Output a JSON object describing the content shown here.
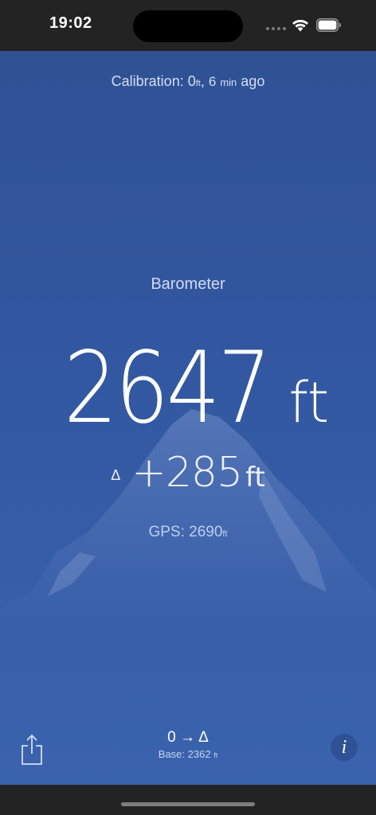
{
  "status_bar": {
    "time": "19:02"
  },
  "calibration": {
    "prefix": "Calibration: ",
    "value": "0",
    "value_unit": "ft",
    "separator": ", ",
    "minutes": "6",
    "minutes_unit": "min",
    "suffix": " ago"
  },
  "reading": {
    "mode": "Barometer",
    "altitude": "2647",
    "altitude_unit": "ft",
    "delta_symbol": "Δ",
    "delta": "+285",
    "delta_unit": "ft",
    "gps_prefix": "GPS: ",
    "gps_value": "2690",
    "gps_unit": "ft"
  },
  "toolbar": {
    "share_icon": "share-icon",
    "mode_toggle": "0 → Δ",
    "base_prefix": "Base: ",
    "base_value": "2362",
    "base_unit": "ft",
    "info_label": "i"
  },
  "colors": {
    "background_top": "#2f5194",
    "background_bottom": "#3a63ae",
    "status_bar": "#232323"
  }
}
